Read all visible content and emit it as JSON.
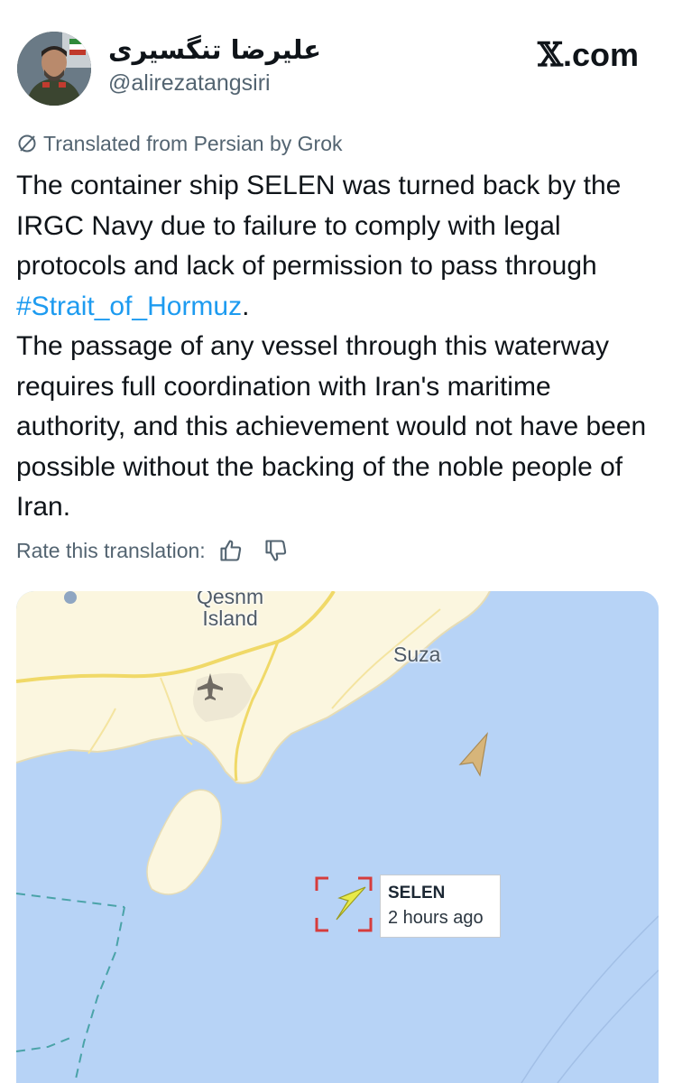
{
  "author": {
    "display_name": "علیرضا تنگسیری",
    "handle": "@alirezatangsiri"
  },
  "brand": {
    "x_glyph": "𝕏",
    "suffix": ".com"
  },
  "tweet": {
    "translation_notice": "Translated from Persian by Grok",
    "paragraph1_before_hashtag": "The container ship SELEN was turned back by the IRGC Navy due to failure to comply with legal protocols and lack of permission to pass through ",
    "hashtag": "#Strait_of_Hormuz",
    "paragraph1_after_hashtag": ".",
    "paragraph2": "The passage of any vessel through this waterway requires full coordination with Iran's maritime authority, and this achievement would not have been possible without the backing of the noble people of Iran.",
    "rate_label": "Rate this translation:"
  },
  "map": {
    "labels": {
      "island_line1": "Qesnm",
      "island_line2": "Island",
      "town": "Suza"
    },
    "vessel": {
      "name": "SELEN",
      "time": "2 hours ago"
    },
    "colors": {
      "sea": "#b7d3f6",
      "land": "#fbf6df",
      "road": "#f0d968",
      "vessel_selected": "#e8ea4a",
      "vessel_other": "#d7b57a",
      "selection_brackets": "#d63c3c"
    }
  },
  "icons": [
    "slash-circle-icon",
    "thumbs-up-icon",
    "thumbs-down-icon",
    "airport-icon"
  ]
}
